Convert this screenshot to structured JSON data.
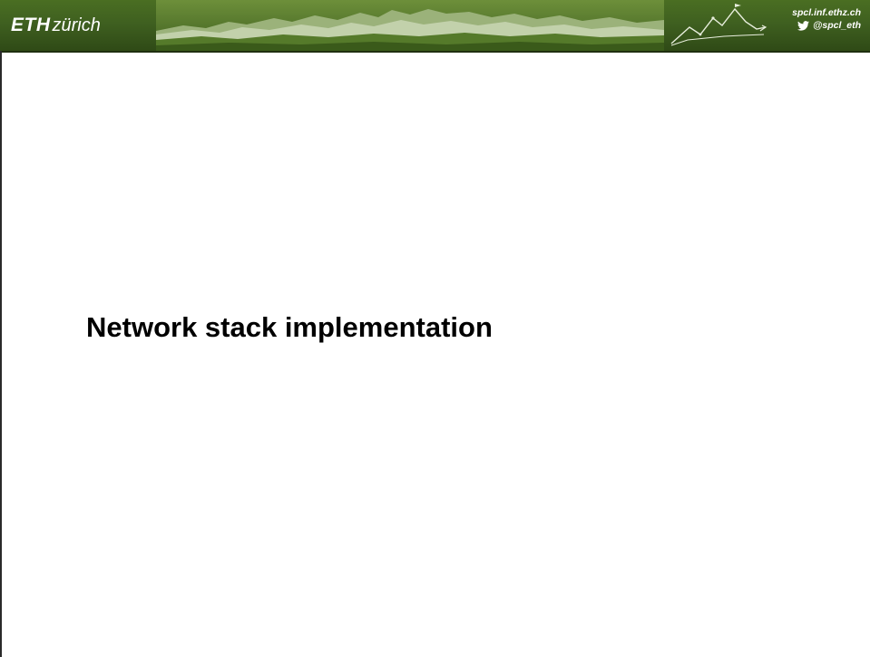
{
  "header": {
    "logo_bold": "ETH",
    "logo_light": "zürich",
    "website": "spcl.inf.ethz.ch",
    "twitter_handle": "@spcl_eth",
    "twitter_icon": "twitter-bird-icon",
    "mountain_logo": "spcl-mountain-logo"
  },
  "slide": {
    "title": "Network stack implementation"
  },
  "colors": {
    "header_green": "#3f6020",
    "header_text": "#ffffff",
    "title_text": "#000000",
    "background": "#ffffff"
  }
}
